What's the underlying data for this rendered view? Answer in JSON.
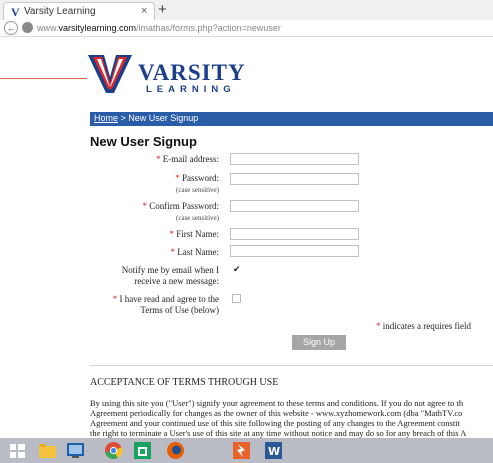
{
  "browser": {
    "tab_title": "Varsity Learning",
    "tab_logo_letter": "V",
    "close_glyph": "×",
    "newtab_glyph": "+",
    "url_prefix": "www.",
    "url_domain": "varsitylearning.com",
    "url_path": "/imathas/forms.php?action=newuser"
  },
  "logo": {
    "word": "VARSITY",
    "sub": "LEARNING",
    "colors": {
      "blue": "#1d3f8a",
      "red": "#d9292b"
    }
  },
  "breadcrumb": {
    "home": "Home",
    "separator": " > ",
    "current": "New User Signup"
  },
  "page_title": "New User Signup",
  "form": {
    "email_label": "E-mail address:",
    "password_label": "Password:",
    "password_note": "(case sensitive)",
    "confirm_label": "Confirm Password:",
    "confirm_note": "(case sensitive)",
    "first_label": "First Name:",
    "last_label": "Last Name:",
    "notify_label_1": "Notify me by email when I",
    "notify_label_2": "receive a new message:",
    "notify_checked": true,
    "check_glyph": "✔",
    "agree_label_1": "I have read and agree to the",
    "agree_label_2": "Terms of Use (below)",
    "agree_checked": false,
    "required_marker": "*",
    "required_note": "indicates a requires field",
    "submit_label": "Sign Up"
  },
  "terms": {
    "heading": "ACCEPTANCE OF TERMS THROUGH USE",
    "lines": [
      "By using this site you (\"User\") signify your agreement to these terms and conditions. If you do not agree to th",
      "Agreement periodically for changes as the owner of this website - www.xyzhomework.com (dba \"MathTV.co",
      "Agreement and your continued use of this site following the posting of any changes to the Agreement constit",
      "the right to terminate a User's use of this site at any time without notice and may do so for any breach of this A"
    ]
  },
  "taskbar": {
    "icons": [
      "windows-start-icon",
      "file-explorer-icon",
      "desktop-app-icon",
      "chrome-icon",
      "store-icon",
      "firefox-icon",
      "app-icon",
      "word-icon"
    ]
  }
}
